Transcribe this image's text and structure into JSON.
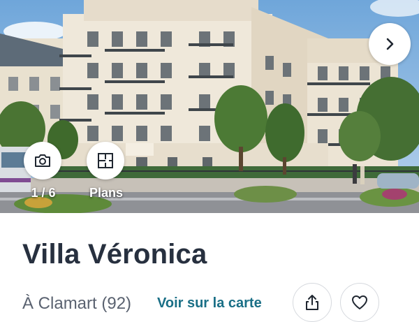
{
  "gallery": {
    "photo_counter": "1 / 6",
    "plans_label": "Plans",
    "next_icon": "chevron-right-icon",
    "photo_icon": "camera-icon",
    "plans_icon": "floor-plan-icon"
  },
  "listing": {
    "title": "Villa Véronica",
    "location": "À Clamart (92)",
    "map_link": "Voir sur la carte",
    "building_sign": "Villa Véronica"
  },
  "actions": {
    "share_icon": "share-icon",
    "favorite_icon": "heart-icon"
  },
  "colors": {
    "title": "#27303f",
    "link": "#1a6f86",
    "border": "#d6d9de"
  }
}
